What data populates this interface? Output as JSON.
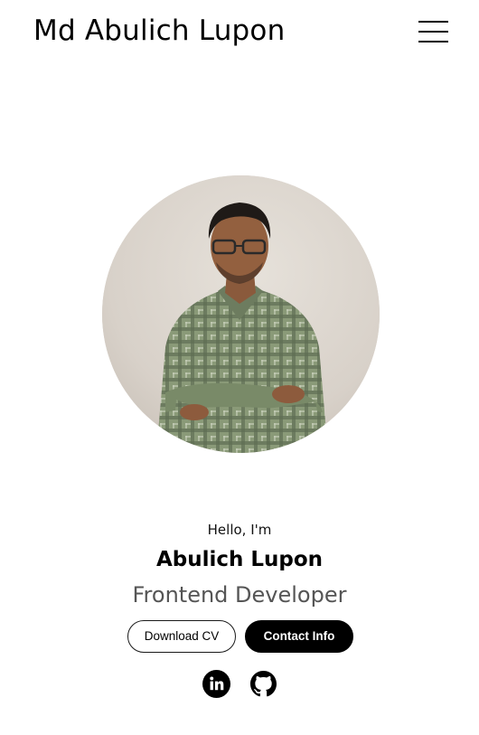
{
  "header": {
    "logo_text": "Md Abulich Lupon",
    "menu_icon": "hamburger-menu-icon"
  },
  "hero": {
    "photo": "profile-photo",
    "greeting": "Hello, I'm",
    "name": "Abulich Lupon",
    "role": "Frontend Developer"
  },
  "buttons": {
    "download_cv": "Download CV",
    "contact_info": "Contact Info"
  },
  "social": {
    "icons": [
      "linkedin-icon",
      "github-icon"
    ]
  },
  "colors": {
    "background": "#ffffff",
    "text_primary": "#000000",
    "text_role": "#555555",
    "button_dark": "#000000",
    "button_light": "#ffffff"
  }
}
